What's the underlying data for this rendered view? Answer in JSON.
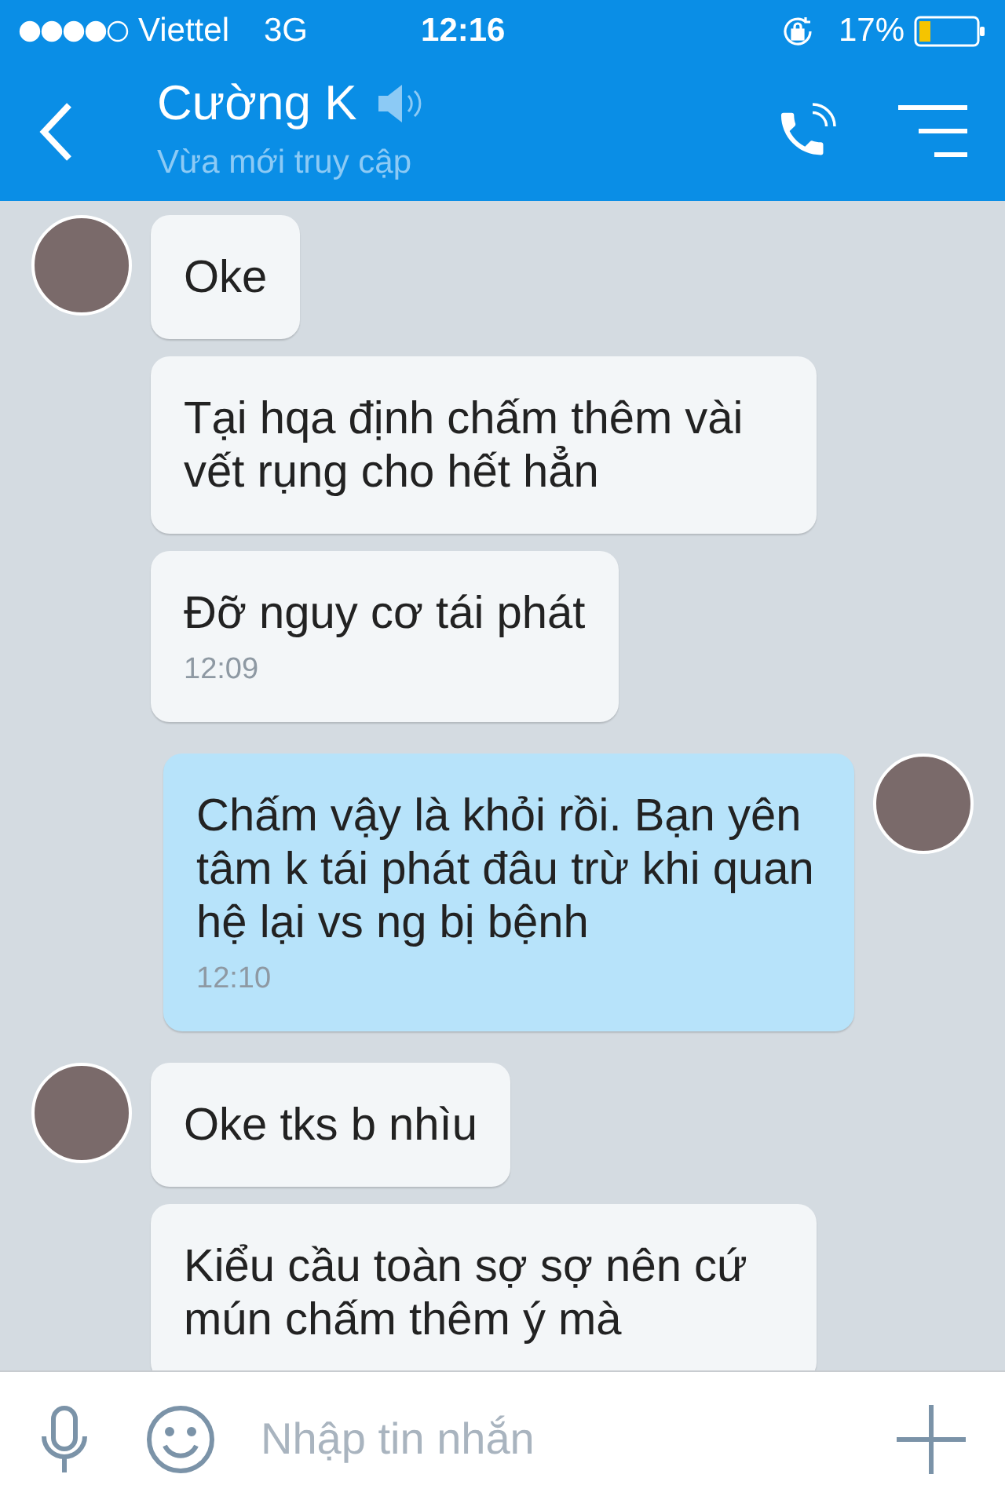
{
  "status_bar": {
    "carrier": "Viettel",
    "network": "3G",
    "time": "12:16",
    "battery": "17%"
  },
  "header": {
    "name": "Cường K",
    "status": "Vừa mới truy cập"
  },
  "messages": [
    {
      "kind": "incoming",
      "avatar": true,
      "text": "Oke"
    },
    {
      "kind": "incoming",
      "avatar": false,
      "text": "Tại hqa định chấm thêm vài vết rụng cho hết hẳn"
    },
    {
      "kind": "incoming",
      "avatar": false,
      "text": "Đỡ nguy cơ tái phát",
      "time": "12:09"
    },
    {
      "kind": "outgoing",
      "avatar": true,
      "text": "Chấm vậy là khỏi rồi. Bạn yên tâm k tái phát đâu trừ khi quan hệ lại vs ng bị bệnh",
      "time": "12:10"
    },
    {
      "kind": "incoming",
      "avatar": true,
      "text": "Oke tks b nhìu"
    },
    {
      "kind": "incoming",
      "avatar": false,
      "text": "Kiểu cầu toàn sợ sợ nên cứ mún chấm thêm ý mà"
    }
  ],
  "composer": {
    "placeholder": "Nhập tin nhắn"
  }
}
